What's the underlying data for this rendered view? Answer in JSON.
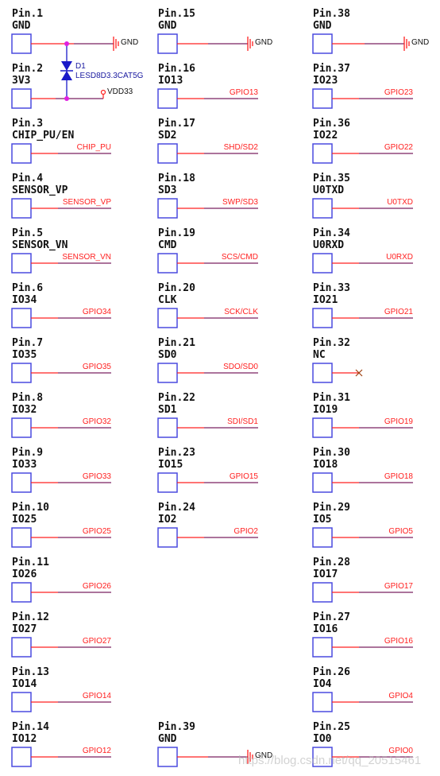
{
  "colors": {
    "box": "#4a4adf",
    "wire": "#ff2020",
    "bus": "#7a2060",
    "junction": "#e020e0",
    "diode": "#1a1ac8",
    "nc": "#a04010"
  },
  "columns": [
    [
      {
        "pin": "Pin.1",
        "name": "GND",
        "net": "GND",
        "type": "gnd"
      },
      {
        "pin": "Pin.2",
        "name": "3V3",
        "net": "VDD33",
        "type": "power"
      },
      {
        "pin": "Pin.3",
        "name": "CHIP_PU/EN",
        "net": "CHIP_PU",
        "type": "net"
      },
      {
        "pin": "Pin.4",
        "name": "SENSOR_VP",
        "net": "SENSOR_VP",
        "type": "net"
      },
      {
        "pin": "Pin.5",
        "name": "SENSOR_VN",
        "net": "SENSOR_VN",
        "type": "net"
      },
      {
        "pin": "Pin.6",
        "name": "IO34",
        "net": "GPIO34",
        "type": "net"
      },
      {
        "pin": "Pin.7",
        "name": "IO35",
        "net": "GPIO35",
        "type": "net"
      },
      {
        "pin": "Pin.8",
        "name": "IO32",
        "net": "GPIO32",
        "type": "net"
      },
      {
        "pin": "Pin.9",
        "name": "IO33",
        "net": "GPIO33",
        "type": "net"
      },
      {
        "pin": "Pin.10",
        "name": "IO25",
        "net": "GPIO25",
        "type": "net"
      },
      {
        "pin": "Pin.11",
        "name": "IO26",
        "net": "GPIO26",
        "type": "net"
      },
      {
        "pin": "Pin.12",
        "name": "IO27",
        "net": "GPIO27",
        "type": "net"
      },
      {
        "pin": "Pin.13",
        "name": "IO14",
        "net": "GPIO14",
        "type": "net"
      },
      {
        "pin": "Pin.14",
        "name": "IO12",
        "net": "GPIO12",
        "type": "net"
      }
    ],
    [
      {
        "pin": "Pin.15",
        "name": "GND",
        "net": "GND",
        "type": "gnd"
      },
      {
        "pin": "Pin.16",
        "name": "IO13",
        "net": "GPIO13",
        "type": "net"
      },
      {
        "pin": "Pin.17",
        "name": "SD2",
        "net": "SHD/SD2",
        "type": "net"
      },
      {
        "pin": "Pin.18",
        "name": "SD3",
        "net": "SWP/SD3",
        "type": "net"
      },
      {
        "pin": "Pin.19",
        "name": "CMD",
        "net": "SCS/CMD",
        "type": "net"
      },
      {
        "pin": "Pin.20",
        "name": "CLK",
        "net": "SCK/CLK",
        "type": "net"
      },
      {
        "pin": "Pin.21",
        "name": "SD0",
        "net": "SDO/SD0",
        "type": "net"
      },
      {
        "pin": "Pin.22",
        "name": "SD1",
        "net": "SDI/SD1",
        "type": "net"
      },
      {
        "pin": "Pin.23",
        "name": "IO15",
        "net": "GPIO15",
        "type": "net"
      },
      {
        "pin": "Pin.24",
        "name": "IO2",
        "net": "GPIO2",
        "type": "net"
      },
      null,
      null,
      null,
      {
        "pin": "Pin.39",
        "name": "GND",
        "net": "GND",
        "type": "gnd"
      }
    ],
    [
      {
        "pin": "Pin.38",
        "name": "GND",
        "net": "GND",
        "type": "gnd"
      },
      {
        "pin": "Pin.37",
        "name": "IO23",
        "net": "GPIO23",
        "type": "net"
      },
      {
        "pin": "Pin.36",
        "name": "IO22",
        "net": "GPIO22",
        "type": "net"
      },
      {
        "pin": "Pin.35",
        "name": "U0TXD",
        "net": "U0TXD",
        "type": "net"
      },
      {
        "pin": "Pin.34",
        "name": "U0RXD",
        "net": "U0RXD",
        "type": "net"
      },
      {
        "pin": "Pin.33",
        "name": "IO21",
        "net": "GPIO21",
        "type": "net"
      },
      {
        "pin": "Pin.32",
        "name": "NC",
        "net": "",
        "type": "nc"
      },
      {
        "pin": "Pin.31",
        "name": "IO19",
        "net": "GPIO19",
        "type": "net"
      },
      {
        "pin": "Pin.30",
        "name": "IO18",
        "net": "GPIO18",
        "type": "net"
      },
      {
        "pin": "Pin.29",
        "name": "IO5",
        "net": "GPIO5",
        "type": "net"
      },
      {
        "pin": "Pin.28",
        "name": "IO17",
        "net": "GPIO17",
        "type": "net"
      },
      {
        "pin": "Pin.27",
        "name": "IO16",
        "net": "GPIO16",
        "type": "net"
      },
      {
        "pin": "Pin.26",
        "name": "IO4",
        "net": "GPIO4",
        "type": "net"
      },
      {
        "pin": "Pin.25",
        "name": "IO0",
        "net": "GPIO0",
        "type": "net"
      }
    ]
  ],
  "diode": {
    "ref": "D1",
    "part": "LESD8D3.3CAT5G"
  },
  "watermark": "https://blog.csdn.net/qq_20515461"
}
